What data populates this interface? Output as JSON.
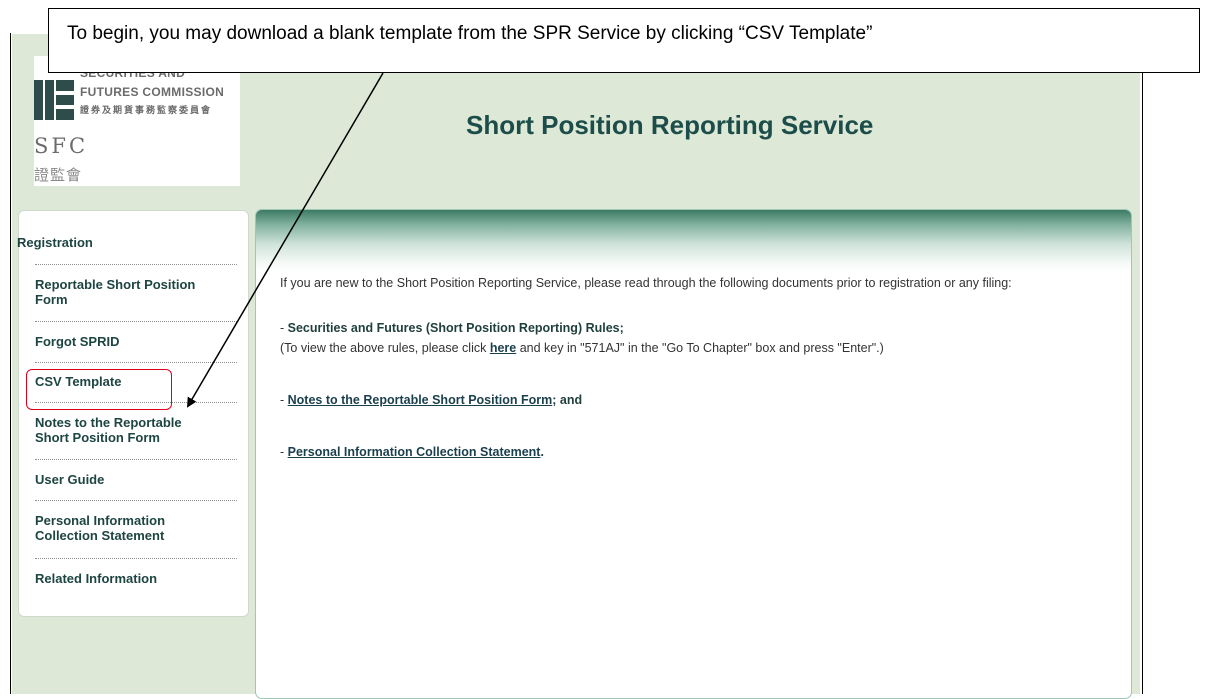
{
  "annotation": {
    "callout_text": "To begin, you may download a blank template from the SPR Service by clicking “CSV Template”"
  },
  "logo": {
    "line1": "SECURITIES AND",
    "line2": "FUTURES COMMISSION",
    "line3": "證券及期貨事務監察委員會",
    "abbr": "SFC",
    "cn_abbr": "證監會"
  },
  "header": {
    "title": "Short Position Reporting Service"
  },
  "sidebar": {
    "items": [
      {
        "label": "Registration"
      },
      {
        "label": "Reportable Short Position Form"
      },
      {
        "label": "Forgot SPRID"
      },
      {
        "label": "CSV Template"
      },
      {
        "label": "Notes to the Reportable Short Position Form"
      },
      {
        "label": "User Guide"
      },
      {
        "label": "Personal Information Collection Statement"
      },
      {
        "label": "Related Information"
      }
    ]
  },
  "main": {
    "intro": "If you are new to the Short Position Reporting Service, please read through the following documents prior to registration or any filing:",
    "rules_prefix": "- ",
    "rules_title": "Securities and Futures (Short Position Reporting) Rules;",
    "rules_note_before": "(To view the above rules, please click ",
    "rules_note_link": "here",
    "rules_note_after": " and key in \"571AJ\" in the \"Go To Chapter\" box and press \"Enter\".)",
    "notes_prefix": "- ",
    "notes_link": "Notes to the Reportable Short Position Form",
    "notes_suffix": "; and",
    "pics_prefix": "- ",
    "pics_link": "Personal Information Collection Statement",
    "pics_suffix": "."
  },
  "colors": {
    "accent_green": "#1d4d4a",
    "page_bg": "#dde9d6",
    "highlight_red": "#e0001b"
  }
}
